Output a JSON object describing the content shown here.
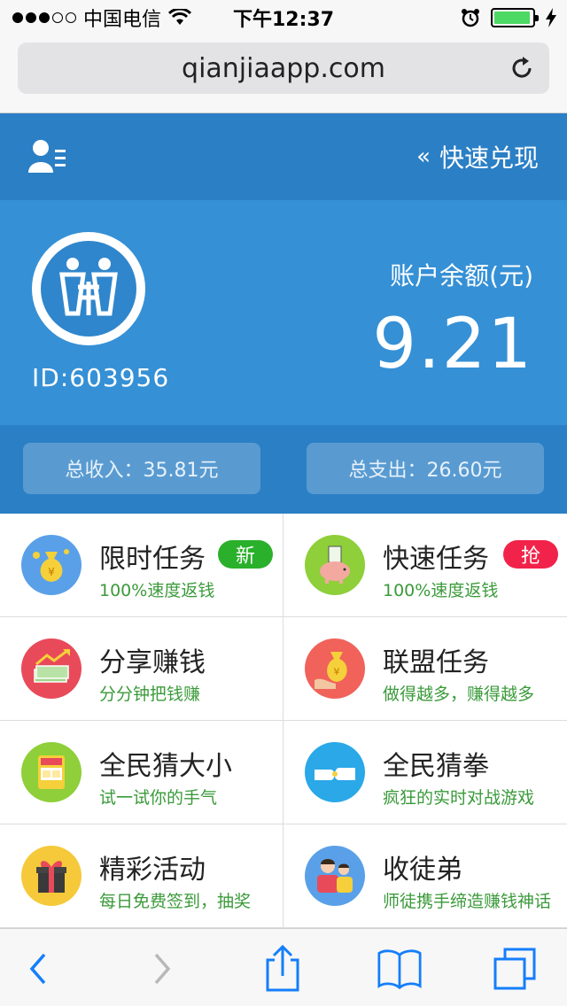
{
  "status": {
    "carrier": "中国电信",
    "time": "下午12:37",
    "battery_level": 0.95,
    "signal_bars": 3
  },
  "browser": {
    "url": "qianjiaapp.com"
  },
  "header": {
    "cashout_label": "快速兑现",
    "chevron": "«"
  },
  "account": {
    "user_id": "ID:603956",
    "balance_label": "账户余额(元)",
    "balance_value": "9.21",
    "total_income": "总收入：35.81元",
    "total_expense": "总支出：26.60元"
  },
  "tasks": [
    {
      "title": "限时任务",
      "subtitle": "100%速度返钱",
      "badge": "新",
      "icon": "money-bag-icon",
      "color": "#5aa0e8"
    },
    {
      "title": "快速任务",
      "subtitle": "100%速度返钱",
      "badge": "抢",
      "icon": "piggy-bank-icon",
      "color": "#8ecf3a"
    },
    {
      "title": "分享赚钱",
      "subtitle": "分分钟把钱赚",
      "badge": "",
      "icon": "cash-stack-icon",
      "color": "#e84a5a"
    },
    {
      "title": "联盟任务",
      "subtitle": "做得越多，赚得越多",
      "badge": "",
      "icon": "coin-hand-icon",
      "color": "#f0625a"
    },
    {
      "title": "全民猜大小",
      "subtitle": "试一试你的手气",
      "badge": "",
      "icon": "guess-machine-icon",
      "color": "#8ecf3a"
    },
    {
      "title": "全民猜拳",
      "subtitle": "疯狂的实时对战游戏",
      "badge": "",
      "icon": "fist-bump-icon",
      "color": "#2aa8e8"
    },
    {
      "title": "精彩活动",
      "subtitle": "每日免费签到，抽奖",
      "badge": "",
      "icon": "gift-box-icon",
      "color": "#f5c93a"
    },
    {
      "title": "收徒弟",
      "subtitle": "师徒携手缔造赚钱神话",
      "badge": "",
      "icon": "master-apprentice-icon",
      "color": "#5aa0e8"
    }
  ],
  "colors": {
    "header": "#2b7fc5",
    "panel": "#3590d6",
    "accent_green": "#3a9a3a",
    "badge_new": "#2ab02a",
    "badge_grab": "#f2234a",
    "ios_blue": "#147efb"
  }
}
